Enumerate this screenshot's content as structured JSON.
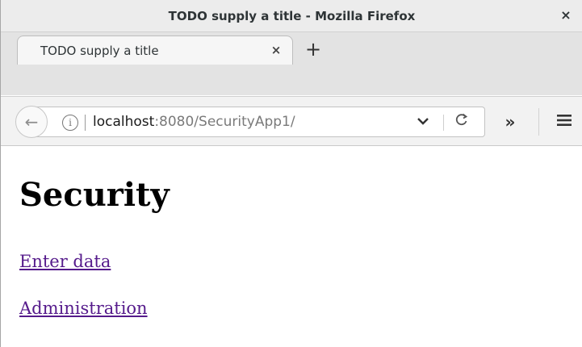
{
  "window": {
    "title": "TODO supply a title - Mozilla Firefox",
    "close_glyph": "×"
  },
  "tabs": [
    {
      "label": "TODO supply a title",
      "close_glyph": "×",
      "active": true
    }
  ],
  "new_tab_glyph": "+",
  "navbar": {
    "back_glyph": "←",
    "info_glyph": "i",
    "url_host": "localhost",
    "url_rest": ":8080/SecurityApp1/",
    "dropdown_glyph": "✔",
    "reload_glyph": "C",
    "overflow_glyph": "»",
    "menu_glyph": "≡"
  },
  "page": {
    "heading": "Security",
    "links": [
      {
        "label": "Enter data"
      },
      {
        "label": "Administration"
      }
    ]
  },
  "colors": {
    "visited_link": "#551a8b",
    "titlebar_bg": "#ececec",
    "tabstrip_bg": "#e3e3e3",
    "navbar_bg": "#f2f2f2"
  },
  "icons": [
    "close-icon",
    "new-tab-icon",
    "back-arrow-icon",
    "info-icon",
    "dropdown-chevron-icon",
    "reload-icon",
    "overflow-chevron-icon",
    "hamburger-menu-icon"
  ]
}
